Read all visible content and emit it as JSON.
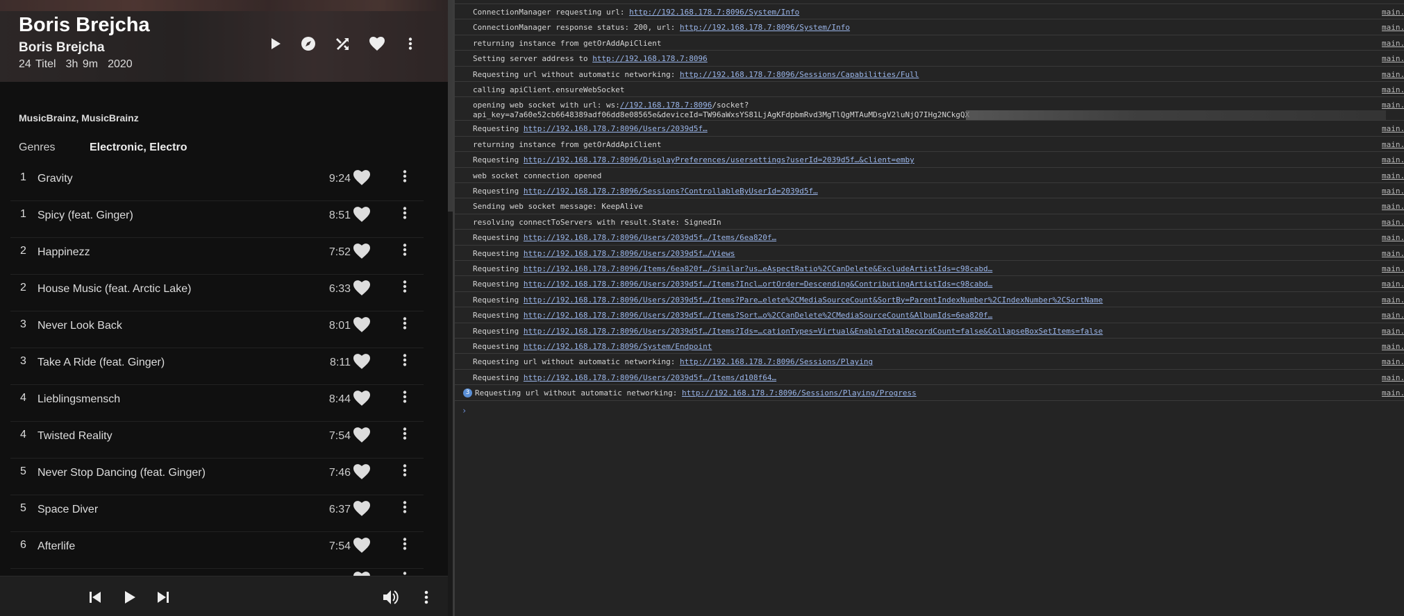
{
  "album": {
    "title": "Boris Brejcha",
    "artist": "Boris Brejcha",
    "track_count": "24 Titel",
    "duration": "3h 9m",
    "year": "2020",
    "studios": "MusicBrainz, MusicBrainz",
    "genres_label": "Genres",
    "genres_value": "Electronic, Electro"
  },
  "hero_icons": [
    "play-icon",
    "compass-icon",
    "shuffle-icon",
    "heart-icon",
    "more-icon"
  ],
  "tracks": [
    {
      "num": "1",
      "name": "Gravity",
      "duration": "9:24"
    },
    {
      "num": "1",
      "name": "Spicy (feat. Ginger)",
      "duration": "8:51"
    },
    {
      "num": "2",
      "name": "Happinezz",
      "duration": "7:52"
    },
    {
      "num": "2",
      "name": "House Music (feat. Arctic Lake)",
      "duration": "6:33"
    },
    {
      "num": "3",
      "name": "Never Look Back",
      "duration": "8:01"
    },
    {
      "num": "3",
      "name": "Take A Ride (feat. Ginger)",
      "duration": "8:11"
    },
    {
      "num": "4",
      "name": "Lieblingsmensch",
      "duration": "8:44"
    },
    {
      "num": "4",
      "name": "Twisted Reality",
      "duration": "7:54"
    },
    {
      "num": "5",
      "name": "Never Stop Dancing (feat. Ginger)",
      "duration": "7:46"
    },
    {
      "num": "5",
      "name": "Space Diver",
      "duration": "6:37"
    },
    {
      "num": "6",
      "name": "Afterlife",
      "duration": "7:54"
    }
  ],
  "player_icons": [
    "skip-previous-icon",
    "play-icon",
    "skip-next-icon",
    "volume-icon",
    "more-icon"
  ],
  "console": {
    "source": "main.",
    "logs": [
      {
        "text": "ConnectionManager requesting url: ",
        "link": "http://192.168.178.7:8096/System/Info"
      },
      {
        "text": "ConnectionManager response status: 200, url: ",
        "link": "http://192.168.178.7:8096/System/Info"
      },
      {
        "text": "returning instance from getOrAddApiClient",
        "link": ""
      },
      {
        "text": "Setting server address to ",
        "link": "http://192.168.178.7:8096"
      },
      {
        "text": "Requesting url without automatic networking: ",
        "link": "http://192.168.178.7:8096/Sessions/Capabilities/Full"
      },
      {
        "text": "calling apiClient.ensureWebSocket",
        "link": ""
      },
      {
        "text": "opening web socket with url: ws:",
        "link": "//192.168.178.7:8096",
        "after": "/socket?",
        "line2": "api_key=a7a60e52cb6648389adf06dd8e08565e&deviceId=TW96aWxsYS81LjAgKFdpbmRvd3MgTlQgMTAuMDsgV2luNjQ7IHg2NCkgQX"
      },
      {
        "text": "Requesting ",
        "link": "http://192.168.178.7:8096/Users/2039d5f…"
      },
      {
        "text": "returning instance from getOrAddApiClient",
        "link": ""
      },
      {
        "text": "Requesting ",
        "link": "http://192.168.178.7:8096/DisplayPreferences/usersettings?userId=2039d5f…&client=emby"
      },
      {
        "text": "web socket connection opened",
        "link": ""
      },
      {
        "text": "Requesting ",
        "link": "http://192.168.178.7:8096/Sessions?ControllableByUserId=2039d5f…"
      },
      {
        "text": "Sending web socket message: KeepAlive",
        "link": ""
      },
      {
        "text": "resolving connectToServers with result.State: SignedIn",
        "link": ""
      },
      {
        "text": "Requesting ",
        "link": "http://192.168.178.7:8096/Users/2039d5f…/Items/6ea820f…"
      },
      {
        "text": "Requesting ",
        "link": "http://192.168.178.7:8096/Users/2039d5f…/Views"
      },
      {
        "text": "Requesting ",
        "link": "http://192.168.178.7:8096/Items/6ea820f…/Similar?us…eAspectRatio%2CCanDelete&ExcludeArtistIds=c98cabd…"
      },
      {
        "text": "Requesting ",
        "link": "http://192.168.178.7:8096/Users/2039d5f…/Items?Incl…ortOrder=Descending&ContributingArtistIds=c98cabd…"
      },
      {
        "text": "Requesting ",
        "link": "http://192.168.178.7:8096/Users/2039d5f…/Items?Pare…elete%2CMediaSourceCount&SortBy=ParentIndexNumber%2CIndexNumber%2CSortName"
      },
      {
        "text": "Requesting ",
        "link": "http://192.168.178.7:8096/Users/2039d5f…/Items?Sort…o%2CCanDelete%2CMediaSourceCount&AlbumIds=6ea820f…"
      },
      {
        "text": "Requesting ",
        "link": "http://192.168.178.7:8096/Users/2039d5f…/Items?Ids=…cationTypes=Virtual&EnableTotalRecordCount=false&CollapseBoxSetItems=false"
      },
      {
        "text": "Requesting ",
        "link": "http://192.168.178.7:8096/System/Endpoint"
      },
      {
        "text": "Requesting url without automatic networking: ",
        "link": "http://192.168.178.7:8096/Sessions/Playing"
      },
      {
        "text": "Requesting ",
        "link": "http://192.168.178.7:8096/Users/2039d5f…/Items/d108f64…"
      },
      {
        "text": "Requesting url without automatic networking: ",
        "link": "http://192.168.178.7:8096/Sessions/Playing/Progress",
        "badge": "3"
      }
    ],
    "prompt": "›"
  }
}
